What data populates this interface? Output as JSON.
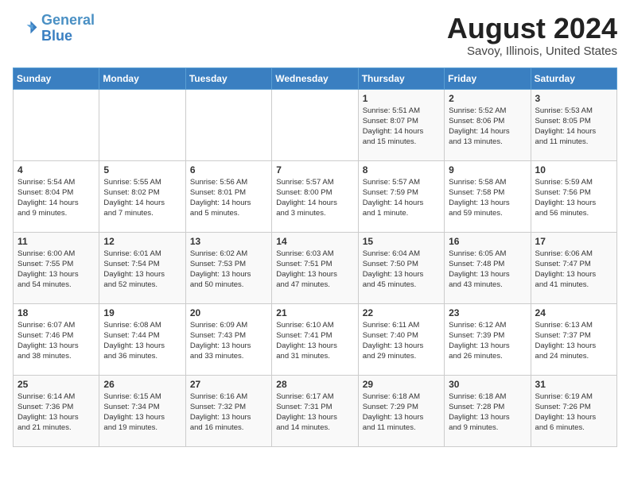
{
  "header": {
    "logo_line1": "General",
    "logo_line2": "Blue",
    "month_year": "August 2024",
    "location": "Savoy, Illinois, United States"
  },
  "days_of_week": [
    "Sunday",
    "Monday",
    "Tuesday",
    "Wednesday",
    "Thursday",
    "Friday",
    "Saturday"
  ],
  "weeks": [
    [
      {
        "day": "",
        "info": ""
      },
      {
        "day": "",
        "info": ""
      },
      {
        "day": "",
        "info": ""
      },
      {
        "day": "",
        "info": ""
      },
      {
        "day": "1",
        "info": "Sunrise: 5:51 AM\nSunset: 8:07 PM\nDaylight: 14 hours\nand 15 minutes."
      },
      {
        "day": "2",
        "info": "Sunrise: 5:52 AM\nSunset: 8:06 PM\nDaylight: 14 hours\nand 13 minutes."
      },
      {
        "day": "3",
        "info": "Sunrise: 5:53 AM\nSunset: 8:05 PM\nDaylight: 14 hours\nand 11 minutes."
      }
    ],
    [
      {
        "day": "4",
        "info": "Sunrise: 5:54 AM\nSunset: 8:04 PM\nDaylight: 14 hours\nand 9 minutes."
      },
      {
        "day": "5",
        "info": "Sunrise: 5:55 AM\nSunset: 8:02 PM\nDaylight: 14 hours\nand 7 minutes."
      },
      {
        "day": "6",
        "info": "Sunrise: 5:56 AM\nSunset: 8:01 PM\nDaylight: 14 hours\nand 5 minutes."
      },
      {
        "day": "7",
        "info": "Sunrise: 5:57 AM\nSunset: 8:00 PM\nDaylight: 14 hours\nand 3 minutes."
      },
      {
        "day": "8",
        "info": "Sunrise: 5:57 AM\nSunset: 7:59 PM\nDaylight: 14 hours\nand 1 minute."
      },
      {
        "day": "9",
        "info": "Sunrise: 5:58 AM\nSunset: 7:58 PM\nDaylight: 13 hours\nand 59 minutes."
      },
      {
        "day": "10",
        "info": "Sunrise: 5:59 AM\nSunset: 7:56 PM\nDaylight: 13 hours\nand 56 minutes."
      }
    ],
    [
      {
        "day": "11",
        "info": "Sunrise: 6:00 AM\nSunset: 7:55 PM\nDaylight: 13 hours\nand 54 minutes."
      },
      {
        "day": "12",
        "info": "Sunrise: 6:01 AM\nSunset: 7:54 PM\nDaylight: 13 hours\nand 52 minutes."
      },
      {
        "day": "13",
        "info": "Sunrise: 6:02 AM\nSunset: 7:53 PM\nDaylight: 13 hours\nand 50 minutes."
      },
      {
        "day": "14",
        "info": "Sunrise: 6:03 AM\nSunset: 7:51 PM\nDaylight: 13 hours\nand 47 minutes."
      },
      {
        "day": "15",
        "info": "Sunrise: 6:04 AM\nSunset: 7:50 PM\nDaylight: 13 hours\nand 45 minutes."
      },
      {
        "day": "16",
        "info": "Sunrise: 6:05 AM\nSunset: 7:48 PM\nDaylight: 13 hours\nand 43 minutes."
      },
      {
        "day": "17",
        "info": "Sunrise: 6:06 AM\nSunset: 7:47 PM\nDaylight: 13 hours\nand 41 minutes."
      }
    ],
    [
      {
        "day": "18",
        "info": "Sunrise: 6:07 AM\nSunset: 7:46 PM\nDaylight: 13 hours\nand 38 minutes."
      },
      {
        "day": "19",
        "info": "Sunrise: 6:08 AM\nSunset: 7:44 PM\nDaylight: 13 hours\nand 36 minutes."
      },
      {
        "day": "20",
        "info": "Sunrise: 6:09 AM\nSunset: 7:43 PM\nDaylight: 13 hours\nand 33 minutes."
      },
      {
        "day": "21",
        "info": "Sunrise: 6:10 AM\nSunset: 7:41 PM\nDaylight: 13 hours\nand 31 minutes."
      },
      {
        "day": "22",
        "info": "Sunrise: 6:11 AM\nSunset: 7:40 PM\nDaylight: 13 hours\nand 29 minutes."
      },
      {
        "day": "23",
        "info": "Sunrise: 6:12 AM\nSunset: 7:39 PM\nDaylight: 13 hours\nand 26 minutes."
      },
      {
        "day": "24",
        "info": "Sunrise: 6:13 AM\nSunset: 7:37 PM\nDaylight: 13 hours\nand 24 minutes."
      }
    ],
    [
      {
        "day": "25",
        "info": "Sunrise: 6:14 AM\nSunset: 7:36 PM\nDaylight: 13 hours\nand 21 minutes."
      },
      {
        "day": "26",
        "info": "Sunrise: 6:15 AM\nSunset: 7:34 PM\nDaylight: 13 hours\nand 19 minutes."
      },
      {
        "day": "27",
        "info": "Sunrise: 6:16 AM\nSunset: 7:32 PM\nDaylight: 13 hours\nand 16 minutes."
      },
      {
        "day": "28",
        "info": "Sunrise: 6:17 AM\nSunset: 7:31 PM\nDaylight: 13 hours\nand 14 minutes."
      },
      {
        "day": "29",
        "info": "Sunrise: 6:18 AM\nSunset: 7:29 PM\nDaylight: 13 hours\nand 11 minutes."
      },
      {
        "day": "30",
        "info": "Sunrise: 6:18 AM\nSunset: 7:28 PM\nDaylight: 13 hours\nand 9 minutes."
      },
      {
        "day": "31",
        "info": "Sunrise: 6:19 AM\nSunset: 7:26 PM\nDaylight: 13 hours\nand 6 minutes."
      }
    ]
  ]
}
